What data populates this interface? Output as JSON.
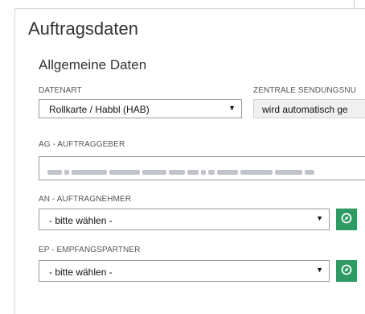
{
  "panel": {
    "title": "Auftragsdaten",
    "section_title": "Allgemeine Daten"
  },
  "fields": {
    "datenart": {
      "label": "DATENART",
      "value": "Rollkarte / Habbl (HAB)"
    },
    "zentrale": {
      "label": "ZENTRALE SENDUNGSNU",
      "value": "wird automatisch ge"
    },
    "ag": {
      "label": "AG - AUFTRAGGEBER",
      "value_obscured": true,
      "visible_tail": "l"
    },
    "an": {
      "label": "AN - AUFTRAGNEHMER",
      "value": "- bitte wählen -"
    },
    "ep": {
      "label": "EP - EMPFANGSPARTNER",
      "value": "- bitte wählen -"
    }
  },
  "icons": {
    "dropdown": "caret-down-icon",
    "green_button": "compass-icon"
  },
  "colors": {
    "accent_green": "#2f9a63"
  }
}
